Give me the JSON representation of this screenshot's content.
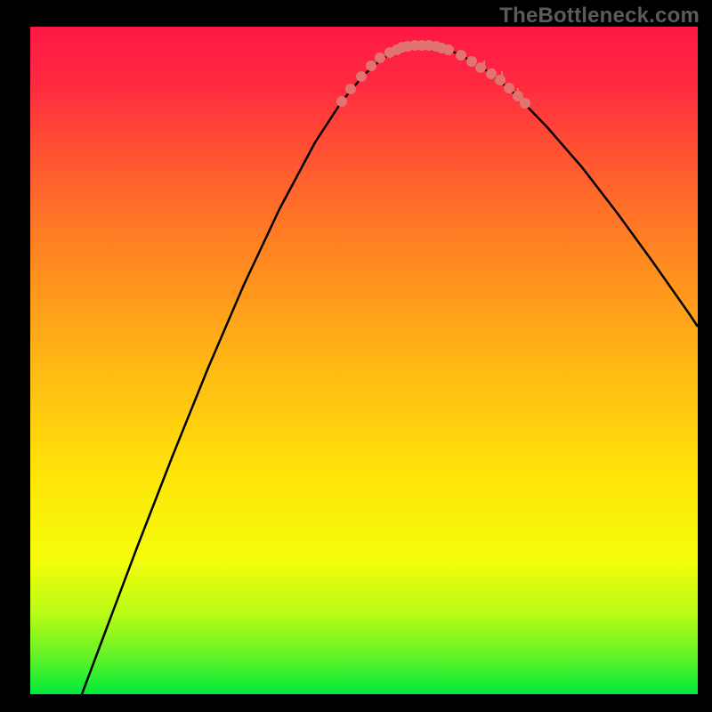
{
  "watermark": "TheBottleneck.com",
  "colors": {
    "dot": "#e2746f",
    "line": "#000000"
  },
  "chart_data": {
    "type": "line",
    "title": "",
    "xlabel": "",
    "ylabel": "",
    "xlim": [
      0,
      750
    ],
    "ylim": [
      0,
      750
    ],
    "series": [
      {
        "name": "bottleneck-curve",
        "x": [
          58,
          85,
          120,
          160,
          200,
          240,
          280,
          320,
          350,
          375,
          395,
          410,
          425,
          440,
          460,
          480,
          498,
          518,
          545,
          580,
          620,
          660,
          700,
          740,
          750
        ],
        "y": [
          0,
          72,
          165,
          268,
          367,
          460,
          545,
          620,
          666,
          696,
          714,
          723,
          728,
          729,
          727,
          720,
          710,
          697,
          674,
          638,
          592,
          540,
          485,
          428,
          413
        ]
      }
    ],
    "markers_left": {
      "x": [
        350,
        360,
        372,
        383,
        393,
        404,
        412,
        418
      ],
      "y": [
        666,
        680,
        694,
        706,
        715,
        721,
        724,
        727
      ]
    },
    "markers_bottom": {
      "x": [
        424,
        432,
        440,
        448,
        456,
        462,
        470
      ],
      "y": [
        728,
        729,
        729,
        729,
        728,
        726,
        724
      ]
    },
    "markers_right": {
      "x": [
        484,
        496,
        506,
        518,
        528,
        538,
        548,
        556
      ],
      "y": [
        718,
        711,
        704,
        697,
        690,
        681,
        672,
        664
      ]
    },
    "right_ticks": {
      "base": [
        {
          "x": 510,
          "y": 702
        },
        {
          "x": 520,
          "y": 696
        },
        {
          "x": 530,
          "y": 688
        },
        {
          "x": 540,
          "y": 680
        },
        {
          "x": 548,
          "y": 672
        }
      ],
      "len": [
        10,
        7,
        12,
        6,
        9
      ]
    }
  }
}
